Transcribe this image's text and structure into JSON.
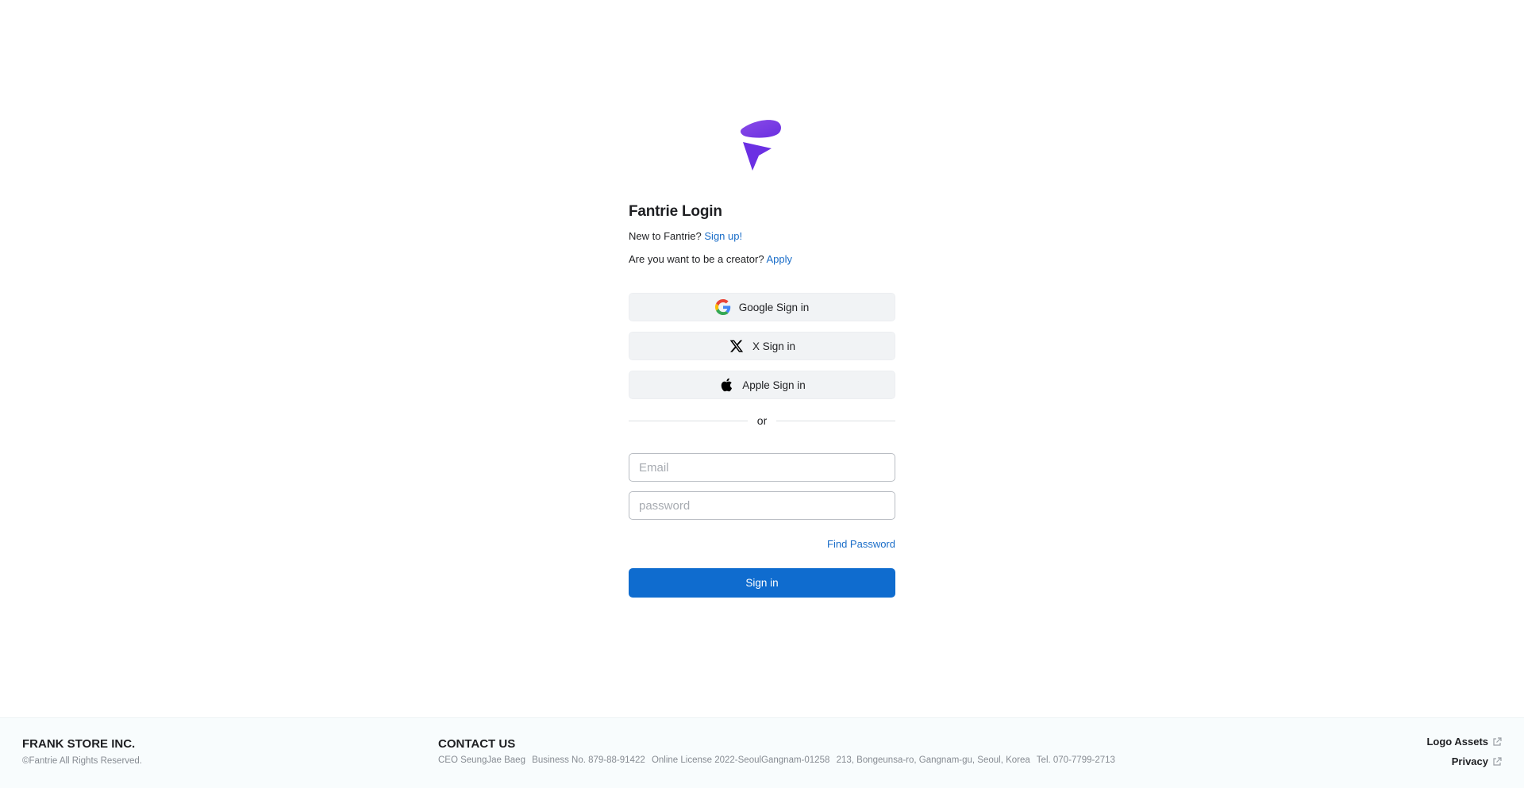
{
  "login": {
    "title": "Fantrie Login",
    "new_prefix": "New to Fantrie?",
    "signup_link": "Sign up!",
    "creator_prefix": "Are you want to be a creator?",
    "apply_link": "Apply",
    "google_label": "Google Sign in",
    "x_label": "X Sign in",
    "apple_label": "Apple Sign in",
    "divider_text": "or",
    "email_placeholder": "Email",
    "password_placeholder": "password",
    "find_password": "Find Password",
    "signin_label": "Sign in"
  },
  "footer": {
    "company": "FRANK STORE INC.",
    "copyright": "©Fantrie All Rights Reserved.",
    "contact_title": "CONTACT US",
    "ceo": "CEO SeungJae Baeg",
    "business_no": "Business No. 879-88-91422",
    "license": "Online License 2022-SeoulGangnam-01258",
    "address": "213, Bongeunsa-ro, Gangnam-gu, Seoul, Korea",
    "tel": "Tel. 070-7799-2713",
    "logo_assets": "Logo Assets",
    "privacy": "Privacy"
  },
  "colors": {
    "brand_purple": "#7b3fe4",
    "link_blue": "#1a6dc8",
    "primary_button": "#0f6ccf"
  },
  "icons": {
    "logo": "fantrie-logo",
    "google": "google-icon",
    "x": "x-icon",
    "apple": "apple-icon",
    "external": "external-link-icon"
  }
}
